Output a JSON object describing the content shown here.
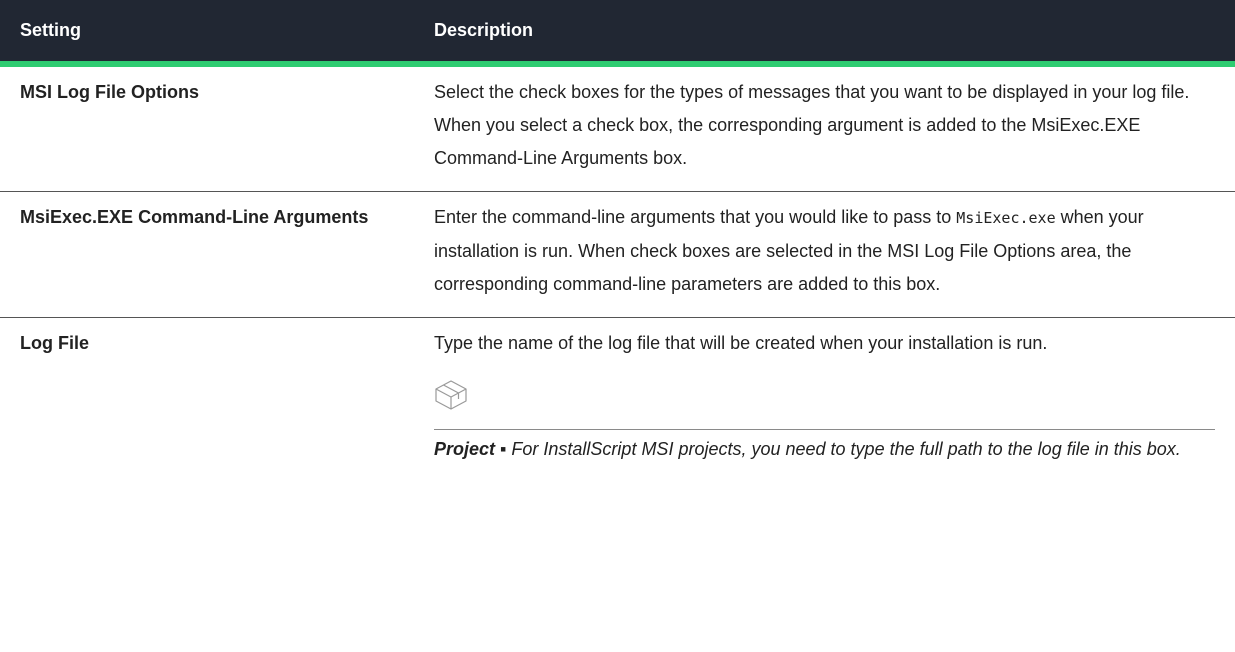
{
  "table": {
    "headers": {
      "setting": "Setting",
      "description": "Description"
    },
    "rows": [
      {
        "name": "MSI Log File Options",
        "description": "Select the check boxes for the types of messages that you want to be displayed in your log file. When you select a check box, the corresponding argument is added to the MsiExec.EXE Command-Line Arguments box."
      },
      {
        "name": "MsiExec.EXE Command-Line Arguments",
        "desc_before": "Enter the command-line arguments that you would like to pass to ",
        "desc_code": "MsiExec.exe",
        "desc_after": " when your installation is run. When check boxes are selected in the MSI Log File Options area, the corresponding command-line parameters are added to this box."
      },
      {
        "name": "Log File",
        "description": "Type the name of the log file that will be created when your installation is run.",
        "note": {
          "icon": "project-box-icon",
          "label": "Project ▪",
          "text": " For InstallScript MSI projects, you need to type the full path to the log file in this box."
        }
      }
    ]
  },
  "colors": {
    "header_bg": "#212733",
    "header_text": "#ffffff",
    "accent": "#2ecc71",
    "row_rule": "#555555"
  }
}
